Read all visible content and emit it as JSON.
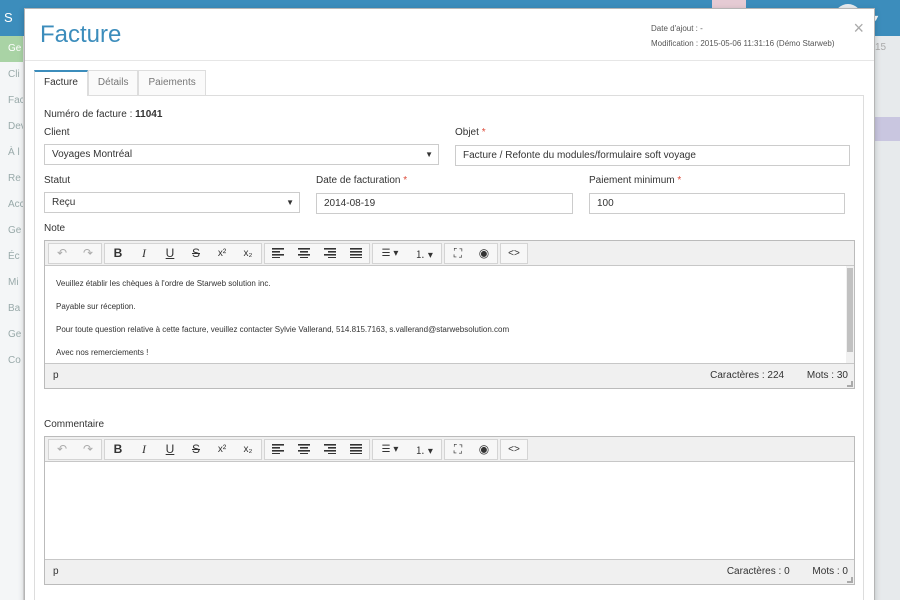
{
  "background": {
    "app_initial": "S",
    "sidebar_items": [
      "Ge",
      "Cli",
      "Fac",
      "Dev",
      "À l",
      "Re",
      "Acc",
      "Ge",
      "Éc",
      "Mi",
      "Ba",
      "Ge",
      "Co"
    ],
    "right_num": "15"
  },
  "modal": {
    "title": "Facture",
    "meta": {
      "date_ajout": "Date d'ajout : -",
      "modification": "Modification : 2015-05-06 11:31:16 (Démo Starweb)"
    },
    "close_label": "×",
    "tabs": [
      {
        "label": "Facture",
        "active": true
      },
      {
        "label": "Détails",
        "active": false
      },
      {
        "label": "Paiements",
        "active": false
      }
    ]
  },
  "form": {
    "numero_label": "Numéro de facture : ",
    "numero_value": "11041",
    "client_label": "Client",
    "client_value": "Voyages Montréal",
    "objet_label": "Objet",
    "objet_value": "Facture / Refonte du modules/formulaire soft voyage",
    "statut_label": "Statut",
    "statut_value": "Reçu",
    "date_label": "Date de facturation",
    "date_value": "2014-08-19",
    "paiement_label": "Paiement minimum",
    "paiement_value": "100",
    "required_mark": "*"
  },
  "note": {
    "label": "Note",
    "paragraphs": [
      "Veuillez établir les chèques à l'ordre de Starweb solution inc.",
      "Payable sur réception.",
      "Pour toute question relative à cette facture, veuillez contacter Sylvie Vallerand, 514.815.7163, s.vallerand@starwebsolution.com",
      "Avec nos remerciements !"
    ],
    "path": "p",
    "chars": "Caractères : 224",
    "words": "Mots : 30"
  },
  "commentaire": {
    "label": "Commentaire",
    "path": "p",
    "chars": "Caractères : 0",
    "words": "Mots : 0"
  },
  "toolbar_glyphs": {
    "undo": "↶",
    "redo": "↷",
    "bold": "B",
    "italic": "I",
    "underline": "U",
    "strike": "S",
    "sup": "x²",
    "sub": "x₂",
    "list_bullet": "☰ ▾",
    "list_num": "⒈ ▾",
    "fullscreen": "⛶",
    "preview": "◉",
    "code": "<>"
  },
  "colors": {
    "accent": "#3c8dbc",
    "required": "#dd4b39"
  }
}
